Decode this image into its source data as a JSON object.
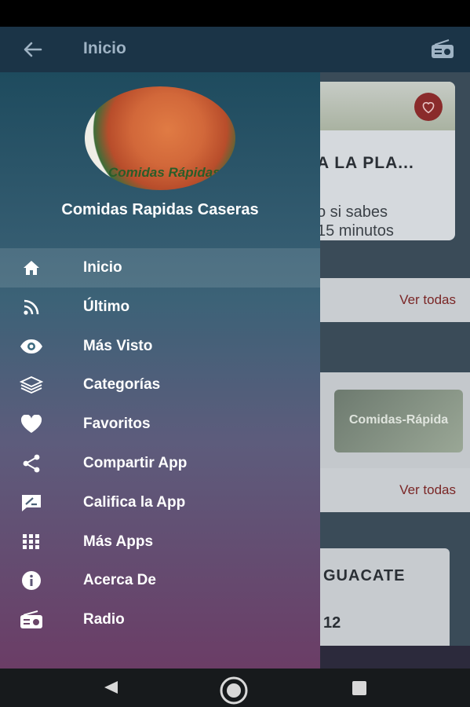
{
  "toolbar": {
    "title": "Inicio"
  },
  "background": {
    "top_card": {
      "title": "A LA PLA...",
      "description": "o si sabes\n15 minutos"
    },
    "sections": [
      {
        "link": "Ver todas"
      },
      {
        "link": "Ver todas"
      }
    ],
    "thumb_text": "Comidas-Rápida",
    "bottom_card": {
      "title": "GUACATE",
      "value": "12"
    }
  },
  "drawer": {
    "app_name": "Comidas Rapidas Caseras",
    "logo_text": "Comidas Rápidas",
    "items": [
      {
        "label": "Inicio",
        "icon": "home-icon"
      },
      {
        "label": "Último",
        "icon": "rss-icon"
      },
      {
        "label": "Más Visto",
        "icon": "eye-icon"
      },
      {
        "label": "Categorías",
        "icon": "layers-icon"
      },
      {
        "label": "Favoritos",
        "icon": "heart-icon"
      },
      {
        "label": "Compartir App",
        "icon": "share-icon"
      },
      {
        "label": "Califica la App",
        "icon": "rate-review-icon"
      },
      {
        "label": "Más Apps",
        "icon": "apps-grid-icon"
      },
      {
        "label": "Acerca De",
        "icon": "info-icon"
      },
      {
        "label": "Radio",
        "icon": "radio-icon"
      }
    ]
  },
  "colors": {
    "toolbar": "#1b3447",
    "accent_link": "#7a2626",
    "drawer_top": "#1e4b5e",
    "drawer_bottom": "#6b3d66"
  }
}
